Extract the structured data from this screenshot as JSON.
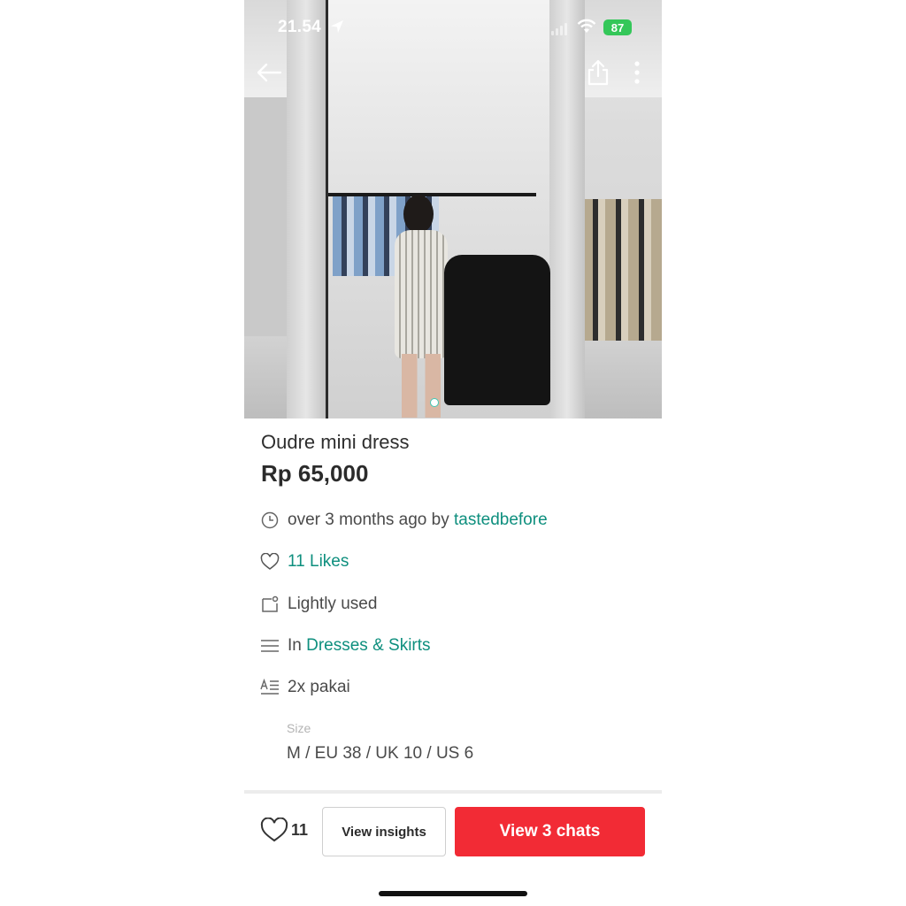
{
  "status_bar": {
    "time": "21.54",
    "battery": "87"
  },
  "listing": {
    "title": "Oudre mini dress",
    "price": "Rp 65,000",
    "posted_prefix": "over 3 months ago by ",
    "seller": "tastedbefore",
    "likes_text": "11 Likes",
    "condition": "Lightly used",
    "category_prefix": "In ",
    "category": "Dresses & Skirts",
    "description": "2x pakai",
    "size_label": "Size",
    "size_value": "M / EU 38 / UK 10 / US 6"
  },
  "bottom_bar": {
    "like_count": "11",
    "insights_label": "View insights",
    "chats_label": "View 3 chats"
  },
  "icons": {
    "back": "back-arrow-icon",
    "share": "share-icon",
    "more": "more-vertical-icon",
    "time": "clock-icon",
    "likes": "heart-icon",
    "condition": "tag-icon",
    "category": "list-icon",
    "description": "text-format-icon"
  },
  "colors": {
    "accent_link": "#0e8f7e",
    "primary_button": "#f22b35",
    "battery": "#34c759"
  }
}
